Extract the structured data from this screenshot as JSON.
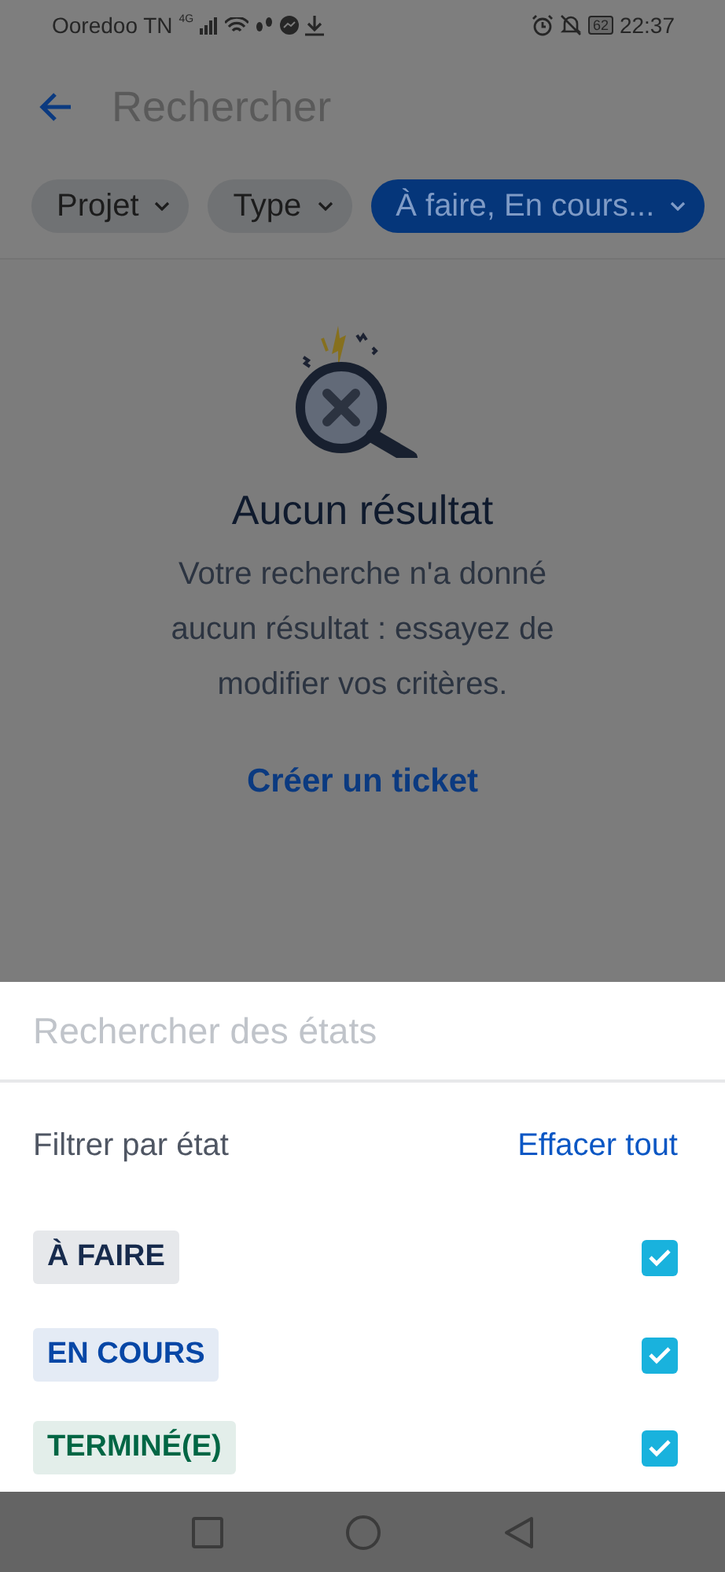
{
  "status_bar": {
    "carrier": "Ooredoo TN",
    "network": "4G",
    "battery": "62",
    "time": "22:37"
  },
  "header": {
    "title_placeholder": "Rechercher"
  },
  "filters": [
    {
      "label": "Projet",
      "selected": false
    },
    {
      "label": "Type",
      "selected": false
    },
    {
      "label": "À faire, En cours...",
      "selected": true
    }
  ],
  "empty_state": {
    "title": "Aucun résultat",
    "message": "Votre recherche n'a donné aucun résultat : essayez de modifier vos critères.",
    "action": "Créer un ticket"
  },
  "sheet": {
    "search_placeholder": "Rechercher des états",
    "section_label": "Filtrer par état",
    "clear_action": "Effacer tout",
    "states": [
      {
        "label": "À FAIRE",
        "color": "#172b4d",
        "checked": true
      },
      {
        "label": "EN COURS",
        "color": "#0747a6",
        "checked": true
      },
      {
        "label": "TERMINÉ(E)",
        "color": "#006644",
        "checked": true
      }
    ]
  }
}
